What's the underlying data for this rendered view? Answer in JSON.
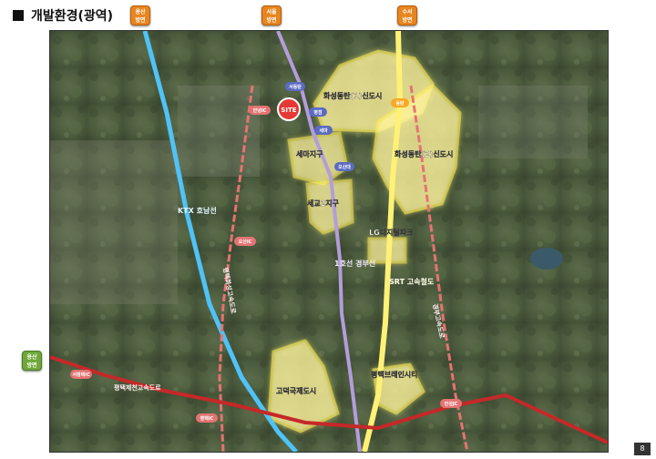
{
  "title": "개발환경(광역)",
  "page_number": "8",
  "direction_buttons": {
    "yongsan_top": "용산\n방면",
    "seoul": "서울\n방면",
    "suseo": "수서\n방면",
    "yongsan_left": "용산\n방면"
  },
  "districts": {
    "dongtan1": "화성동탄(1)신도시",
    "dongtan2": "화성동탄(2)신도시",
    "semat": "세마지구",
    "sedong": "세교2지구",
    "godeok": "고덕국제도시",
    "brain_city": "평택브레인시티",
    "lg_park": "LG디지털파크"
  },
  "lines": {
    "ktx": "KTX\n호남선",
    "gyeongbu": "1호선\n경부선",
    "srt": "SRT\n고속철도",
    "gyeongbu_expressway": "경부고속도로",
    "pyeongtaek_expressway": "평택제천고속도로",
    "seohaean_expressway": "평택화성고속도로"
  },
  "site_marker": "SITE",
  "small_labels": {
    "ic1": "안녕IC",
    "ic2": "오산IC",
    "ic3": "서평택IC",
    "ic4": "안성JC",
    "ic5": "평택IC",
    "station1": "병점",
    "station2": "세마",
    "station3": "오산대",
    "station4": "동탄",
    "station5": "서동탄"
  },
  "colors": {
    "ktx_line": "#4fc3f7",
    "gyeongbu_line": "#b39ddb",
    "srt_line": "#fff176",
    "expressway": "#e57373",
    "district_fill": "#fff59d",
    "district_glow": "#ffee58"
  }
}
